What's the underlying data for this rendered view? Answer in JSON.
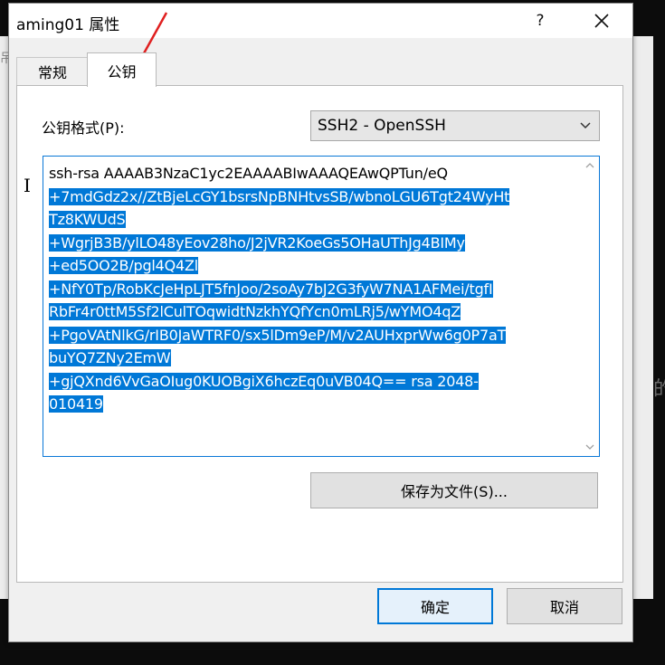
{
  "window": {
    "title": "aming01 属性",
    "help_label": "?",
    "background_right_char": "的",
    "background_left_char": "吊"
  },
  "tabs": [
    {
      "label": "常规",
      "active": false
    },
    {
      "label": "公钥",
      "active": true
    }
  ],
  "format": {
    "label": "公钥格式(P):",
    "selected": "SSH2 - OpenSSH"
  },
  "key_text": {
    "first_unselected": "ssh-rsa AAAAB3NzaC1yc2EAAAABIwAAAQEAwQPTun/eQ",
    "lines": [
      "+7mdGdz2x//ZtBjeLcGY1bsrsNpBNHtvsSB/wbnoLGU6Tgt24WyHt",
      "Tz8KWUdS",
      "+WgrjB3B/ylLO48yEov28ho/J2jVR2KoeGs5OHaUThJg4BIMy",
      "+ed5OO2B/pgl4Q4Zl",
      "+NfY0Tp/RobKcJeHpLJT5fnJoo/2soAy7bJ2G3fyW7NA1AFMei/tgfI",
      "RbFr4r0ttM5Sf2lCulTOqwidtNzkhYQfYcn0mLRj5/wYMO4qZ",
      "+PgoVAtNlkG/rIB0JaWTRF0/sx5lDm9eP/M/v2AUHxprWw6g0P7aT",
      "buYQ7ZNy2EmW",
      "+gjQXnd6VvGaOIug0KUOBgiX6hczEq0uVB04Q== rsa 2048-",
      "010419"
    ]
  },
  "buttons": {
    "save": "保存为文件(S)...",
    "ok": "确定",
    "cancel": "取消"
  },
  "colors": {
    "selection": "#0078d7",
    "annotation_arrow": "#e02020"
  }
}
